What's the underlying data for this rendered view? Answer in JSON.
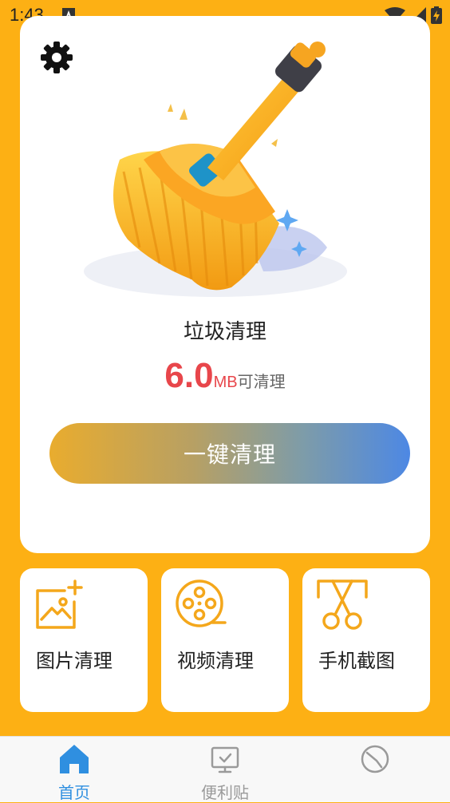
{
  "status_bar": {
    "time": "1:43",
    "notification_icon": "a-icon",
    "wifi_icon": "wifi-icon",
    "cell_icon": "cell-signal-icon",
    "battery_icon": "battery-charging-icon"
  },
  "main": {
    "title": "垃圾清理",
    "junk_size": "6.0",
    "junk_unit": "MB",
    "junk_suffix": "可清理",
    "clean_button_label": "一键清理",
    "settings_icon": "gear-icon",
    "illustration": "broom-illustration"
  },
  "tools": [
    {
      "label": "图片清理",
      "icon": "image-add-icon"
    },
    {
      "label": "视频清理",
      "icon": "film-reel-icon"
    },
    {
      "label": "手机截图",
      "icon": "scissors-icon"
    }
  ],
  "bottom_nav": {
    "items": [
      {
        "label": "首页",
        "icon": "home-icon",
        "active": true
      },
      {
        "label": "便利贴",
        "icon": "note-icon",
        "active": false
      },
      {
        "label": "",
        "icon": "clock-icon",
        "active": false
      }
    ],
    "active_color": "#2F8FE0",
    "inactive_color": "#9A9A9A"
  },
  "colors": {
    "background": "#FDB014",
    "accent_orange": "#F4A71B",
    "size_red": "#E8464B"
  }
}
